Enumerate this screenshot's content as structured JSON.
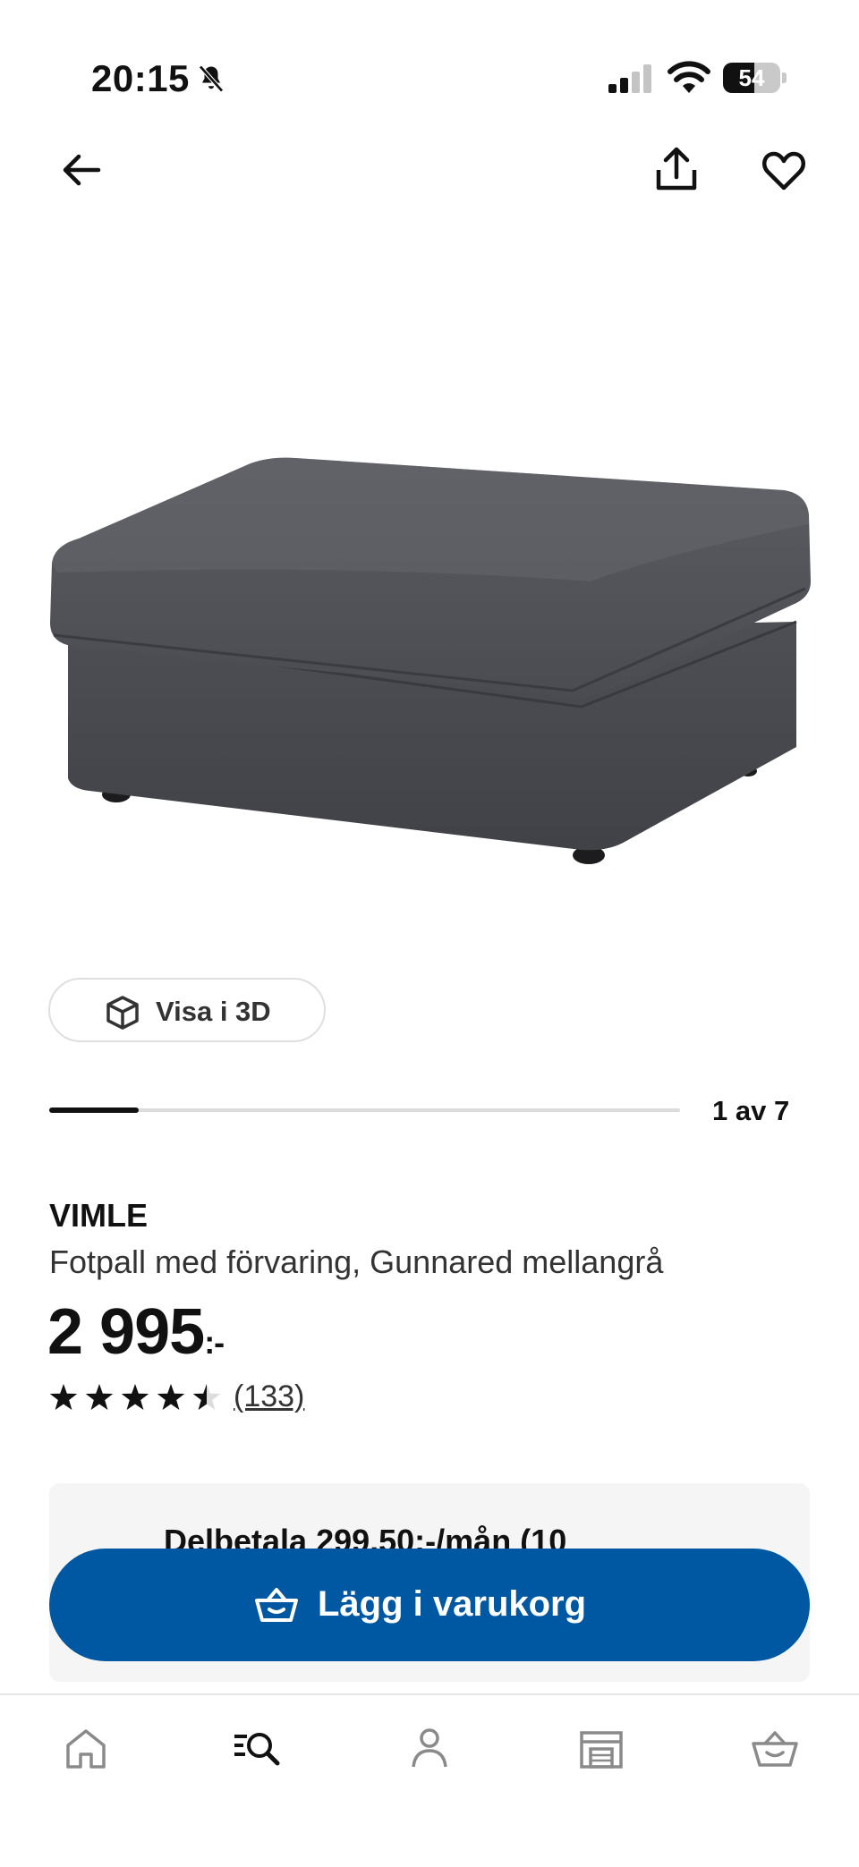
{
  "status_bar": {
    "time": "20:15",
    "battery_level": "54",
    "icons": [
      "bell-slash-icon",
      "signal-icon",
      "wifi-icon",
      "battery-icon"
    ]
  },
  "top_nav": {
    "icons": [
      "arrow-left-icon",
      "share-icon",
      "heart-icon"
    ]
  },
  "gallery": {
    "view_3d_label": "Visa i 3D",
    "position_label": "1 av 7",
    "progress_fraction": 0.142
  },
  "product": {
    "brand": "VIMLE",
    "description": "Fotpall med förvaring, Gunnared mellangrå",
    "price": "2 995",
    "price_suffix": ":-",
    "rating": 4.5,
    "rating_max": 5,
    "review_count": "(133)"
  },
  "finance": {
    "text": "Delbetala 299,50:-/mån (10"
  },
  "cta": {
    "label": "Lägg i varukorg",
    "icon": "basket-icon"
  },
  "bottom_nav": {
    "items": [
      "home-icon",
      "search-icon",
      "profile-icon",
      "store-icon",
      "basket-icon"
    ]
  },
  "colors": {
    "accent": "#0058a3",
    "text": "#111111",
    "panel": "#f5f5f5"
  }
}
